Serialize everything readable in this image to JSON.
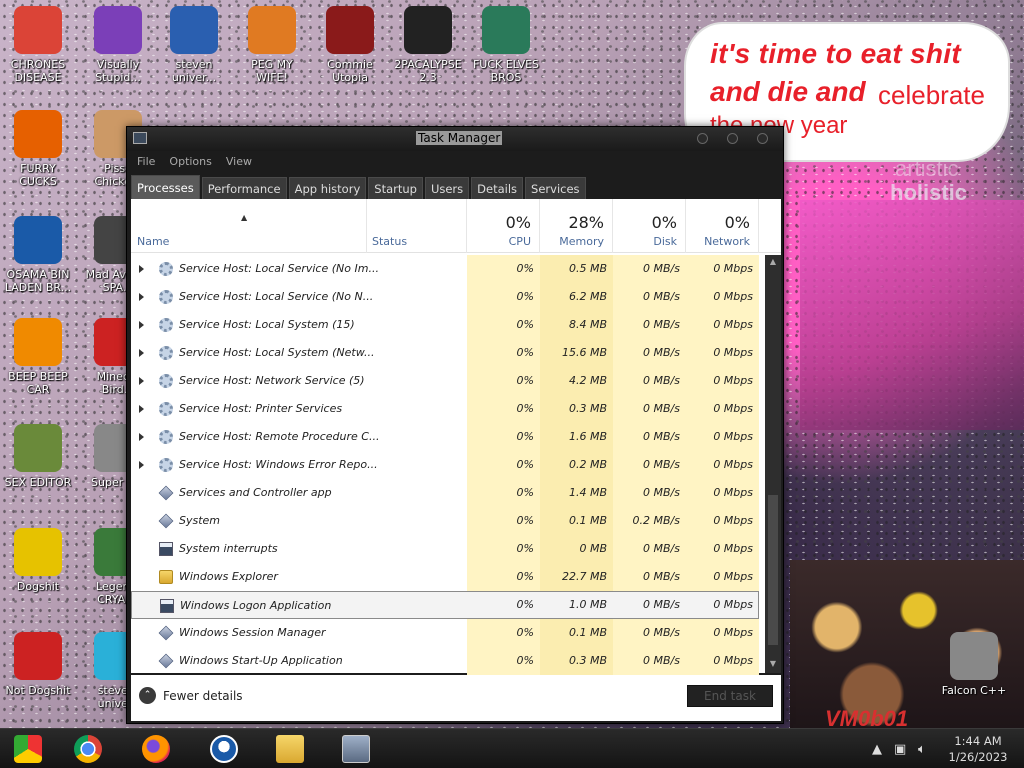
{
  "desktop": {
    "icons": [
      {
        "label": "CHRONES DISEASE",
        "icon": "chrome-icon",
        "color": "#db4437"
      },
      {
        "label": "Visually Stupid...",
        "icon": "visual-studio-icon",
        "color": "#7b3fb8"
      },
      {
        "label": "steven univer...",
        "icon": "game-icon",
        "color": "#2a5fb0"
      },
      {
        "label": "PEG MY WIFE!",
        "icon": "peggle-icon",
        "color": "#e07a22"
      },
      {
        "label": "Commie Utopia",
        "icon": "commie-icon",
        "color": "#8a1a1a"
      },
      {
        "label": "2PACALYPSE 2.3",
        "icon": "terminal-icon",
        "color": "#222222"
      },
      {
        "label": "FUCK ELVES BROS",
        "icon": "santa-icon",
        "color": "#2a7a5a"
      },
      {
        "label": "FURRY CUCKS",
        "icon": "firefox-icon",
        "color": "#e66000"
      },
      {
        "label": "Pisse Chicke...",
        "icon": "chicken-icon",
        "color": "#c96"
      },
      {
        "label": "OSAMA BIN LADEN BR...",
        "icon": "obama-logo-icon",
        "color": "#1a5aa8"
      },
      {
        "label": "Mad Av... IN SPA...",
        "icon": "angry-birds-space-icon",
        "color": "#444"
      },
      {
        "label": "BEEP BEEP CAR",
        "icon": "vlc-icon",
        "color": "#f08a00"
      },
      {
        "label": "Minec... Bird...",
        "icon": "angry-birds-icon",
        "color": "#c22"
      },
      {
        "label": "SEX EDITOR",
        "icon": "hxd-icon",
        "color": "#6a8a3a"
      },
      {
        "label": "Super C...",
        "icon": "pixel-icon",
        "color": "#888"
      },
      {
        "label": "Dogshit",
        "icon": "dogshit-icon",
        "color": "#e6c200"
      },
      {
        "label": "Legen... CRYAI...",
        "icon": "pixel-hero-icon",
        "color": "#3a7a3a"
      },
      {
        "label": "Not Dogshit",
        "icon": "dev-cpp-icon",
        "color": "#c22"
      },
      {
        "label": "steve... unive...",
        "icon": "diamond-icon",
        "color": "#2ab0d8"
      },
      {
        "label": "Falcon C++",
        "icon": "recycle-bin-icon",
        "color": "#888"
      }
    ],
    "wallpaper_text": {
      "line1": "it's time to eat shit",
      "line2": "and die and",
      "line2b": "celebrate",
      "line3": "the new year",
      "sign_a": "artistic",
      "sign_b": "holistic",
      "vm": "VM0b01"
    }
  },
  "window": {
    "title": "Task Manager",
    "menu": [
      "File",
      "Options",
      "View"
    ],
    "tabs": [
      "Processes",
      "Performance",
      "App history",
      "Startup",
      "Users",
      "Details",
      "Services"
    ],
    "active_tab": "Processes",
    "columns": {
      "name": "Name",
      "status": "Status",
      "cpu": {
        "label": "CPU",
        "pct": "0%"
      },
      "memory": {
        "label": "Memory",
        "pct": "28%"
      },
      "disk": {
        "label": "Disk",
        "pct": "0%"
      },
      "network": {
        "label": "Network",
        "pct": "0%"
      }
    },
    "rows": [
      {
        "name": "Service Host: Local Service (No Im...",
        "icon": "gear-icon",
        "expandable": true,
        "cpu": "0%",
        "memory": "0.5 MB",
        "disk": "0 MB/s",
        "network": "0 Mbps"
      },
      {
        "name": "Service Host: Local Service (No N...",
        "icon": "gear-icon",
        "expandable": true,
        "cpu": "0%",
        "memory": "6.2 MB",
        "disk": "0 MB/s",
        "network": "0 Mbps"
      },
      {
        "name": "Service Host: Local System (15)",
        "icon": "gear-icon",
        "expandable": true,
        "cpu": "0%",
        "memory": "8.4 MB",
        "disk": "0 MB/s",
        "network": "0 Mbps"
      },
      {
        "name": "Service Host: Local System (Netw...",
        "icon": "gear-icon",
        "expandable": true,
        "cpu": "0%",
        "memory": "15.6 MB",
        "disk": "0 MB/s",
        "network": "0 Mbps"
      },
      {
        "name": "Service Host: Network Service (5)",
        "icon": "gear-icon",
        "expandable": true,
        "cpu": "0%",
        "memory": "4.2 MB",
        "disk": "0 MB/s",
        "network": "0 Mbps"
      },
      {
        "name": "Service Host: Printer Services",
        "icon": "gear-icon",
        "expandable": true,
        "cpu": "0%",
        "memory": "0.3 MB",
        "disk": "0 MB/s",
        "network": "0 Mbps"
      },
      {
        "name": "Service Host: Remote Procedure C...",
        "icon": "gear-icon",
        "expandable": true,
        "cpu": "0%",
        "memory": "1.6 MB",
        "disk": "0 MB/s",
        "network": "0 Mbps"
      },
      {
        "name": "Service Host: Windows Error Repo...",
        "icon": "gear-icon",
        "expandable": true,
        "cpu": "0%",
        "memory": "0.2 MB",
        "disk": "0 MB/s",
        "network": "0 Mbps"
      },
      {
        "name": "Services and Controller app",
        "icon": "diamond-process-icon",
        "expandable": false,
        "cpu": "0%",
        "memory": "1.4 MB",
        "disk": "0 MB/s",
        "network": "0 Mbps"
      },
      {
        "name": "System",
        "icon": "diamond-process-icon",
        "expandable": false,
        "cpu": "0%",
        "memory": "0.1 MB",
        "disk": "0.2 MB/s",
        "network": "0 Mbps"
      },
      {
        "name": "System interrupts",
        "icon": "window-process-icon",
        "expandable": false,
        "cpu": "0%",
        "memory": "0 MB",
        "disk": "0 MB/s",
        "network": "0 Mbps"
      },
      {
        "name": "Windows Explorer",
        "icon": "folder-icon",
        "expandable": false,
        "cpu": "0%",
        "memory": "22.7 MB",
        "disk": "0 MB/s",
        "network": "0 Mbps"
      },
      {
        "name": "Windows Logon Application",
        "icon": "window-process-icon",
        "expandable": false,
        "selected": true,
        "cpu": "0%",
        "memory": "1.0 MB",
        "disk": "0 MB/s",
        "network": "0 Mbps"
      },
      {
        "name": "Windows Session Manager",
        "icon": "diamond-process-icon",
        "expandable": false,
        "cpu": "0%",
        "memory": "0.1 MB",
        "disk": "0 MB/s",
        "network": "0 Mbps"
      },
      {
        "name": "Windows Start-Up Application",
        "icon": "diamond-process-icon",
        "expandable": false,
        "cpu": "0%",
        "memory": "0.3 MB",
        "disk": "0 MB/s",
        "network": "0 Mbps"
      }
    ],
    "footer": {
      "fewer_details": "Fewer details",
      "end_task": "End task"
    }
  },
  "taskbar": {
    "pinned": [
      "chrome-old-icon",
      "chrome-icon",
      "firefox-icon",
      "obama-logo-icon",
      "file-explorer-icon",
      "task-manager-icon"
    ],
    "clock_time": "1:44 AM",
    "clock_date": "1/26/2023"
  }
}
